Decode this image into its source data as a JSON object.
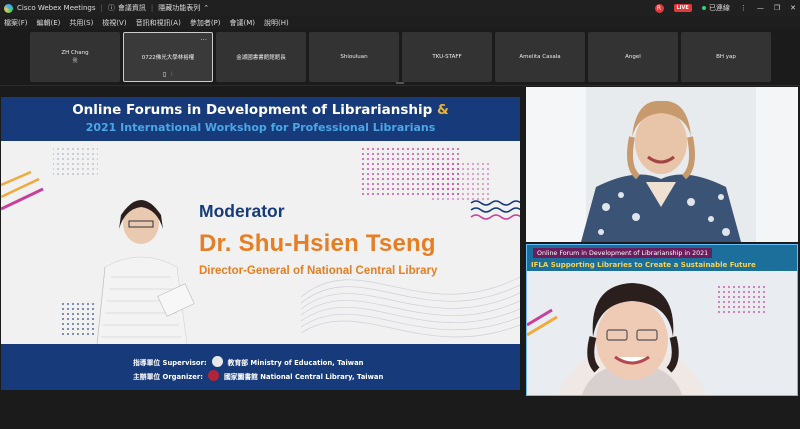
{
  "titlebar": {
    "app_name": "Cisco Webex Meetings",
    "meeting_info": "會議資訊",
    "hide_menu": "隱藏功能表列",
    "rec": "R",
    "live": "LIVE",
    "connected": "已連線"
  },
  "menu": [
    "檔案(F)",
    "編輯(E)",
    "共用(S)",
    "檢視(V)",
    "音訊和視訊(A)",
    "參加者(P)",
    "會議(M)",
    "說明(H)"
  ],
  "participants": [
    {
      "name": "ZH Chang",
      "sub": "我"
    },
    {
      "name": "0722佛光大學林裕權",
      "sub": ""
    },
    {
      "name": "金湖國書書館館館長",
      "sub": ""
    },
    {
      "name": "Shiouluan",
      "sub": ""
    },
    {
      "name": "TKU-STAFF",
      "sub": ""
    },
    {
      "name": "Amelita Casala",
      "sub": ""
    },
    {
      "name": "Angel",
      "sub": ""
    },
    {
      "name": "BH yap",
      "sub": ""
    }
  ],
  "slide": {
    "title_line1": "Online Forums in Development of Librarianship",
    "title_amp": "&",
    "title_line2": "2021 International Workshop for Professional Librarians",
    "moderator": "Moderator",
    "name": "Dr. Shu-Hsien Tseng",
    "role": "Director-General of National Central Library",
    "supervisor_label": "指導單位 Supervisor:",
    "supervisor_value": "教育部  Ministry of Education, Taiwan",
    "organizer_label": "主辦單位 Organizer:",
    "organizer_value": "國家圖書館  National Central Library, Taiwan"
  },
  "video2": {
    "title": "Online Forum in Development of Librarianship in 2021",
    "subtitle": "IFLA Supporting Libraries to Create a Sustainable Future"
  },
  "colors": {
    "navy": "#173a7a",
    "orange": "#e87e23",
    "accent_blue": "#4aa7e6"
  }
}
